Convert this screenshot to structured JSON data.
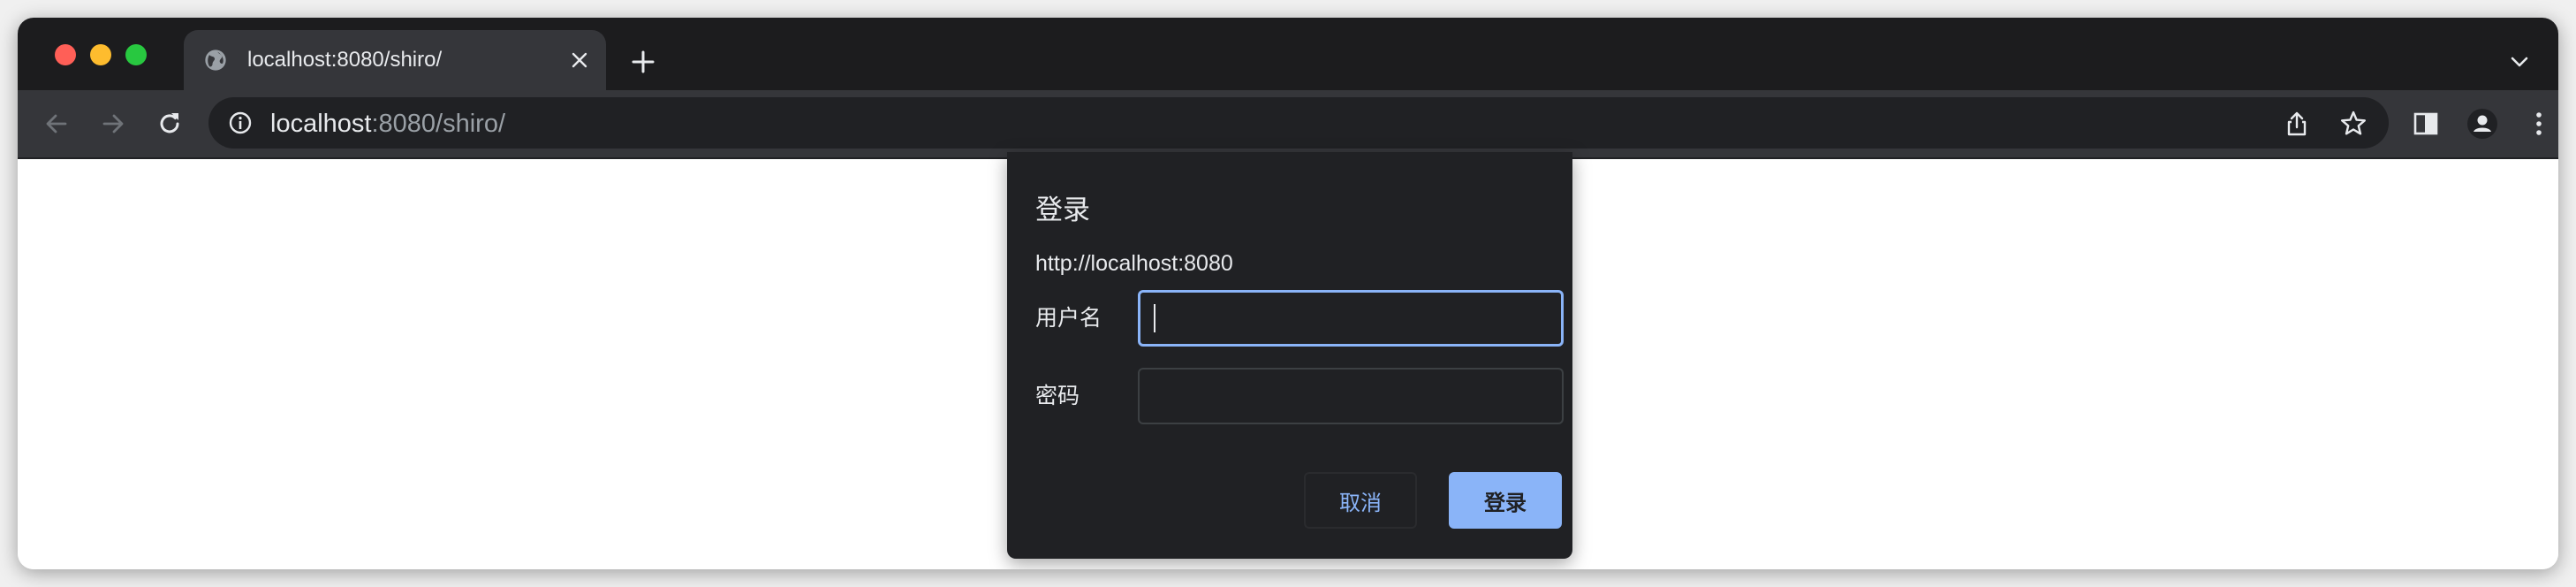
{
  "browser": {
    "tab": {
      "title": "localhost:8080/shiro/",
      "favicon": "globe-icon"
    },
    "toolbar": {
      "url_host": "localhost",
      "url_rest": ":8080/shiro/",
      "icons": [
        "back-arrow-icon",
        "forward-arrow-icon",
        "reload-icon",
        "info-icon",
        "share-icon",
        "star-icon",
        "side-panel-icon",
        "profile-icon",
        "kebab-menu-icon"
      ]
    }
  },
  "dialog": {
    "title": "登录",
    "origin": "http://localhost:8080",
    "username_label": "用户名",
    "password_label": "密码",
    "username_value": "",
    "password_value": "",
    "cancel_label": "取消",
    "login_label": "登录"
  },
  "colors": {
    "accent": "#8ab4f8",
    "dialog_bg": "#202124",
    "titlebar_bg": "#1c1c1e",
    "toolbar_bg": "#35363a",
    "traffic_red": "#ff5f57",
    "traffic_yellow": "#febc2e",
    "traffic_green": "#28c840"
  }
}
